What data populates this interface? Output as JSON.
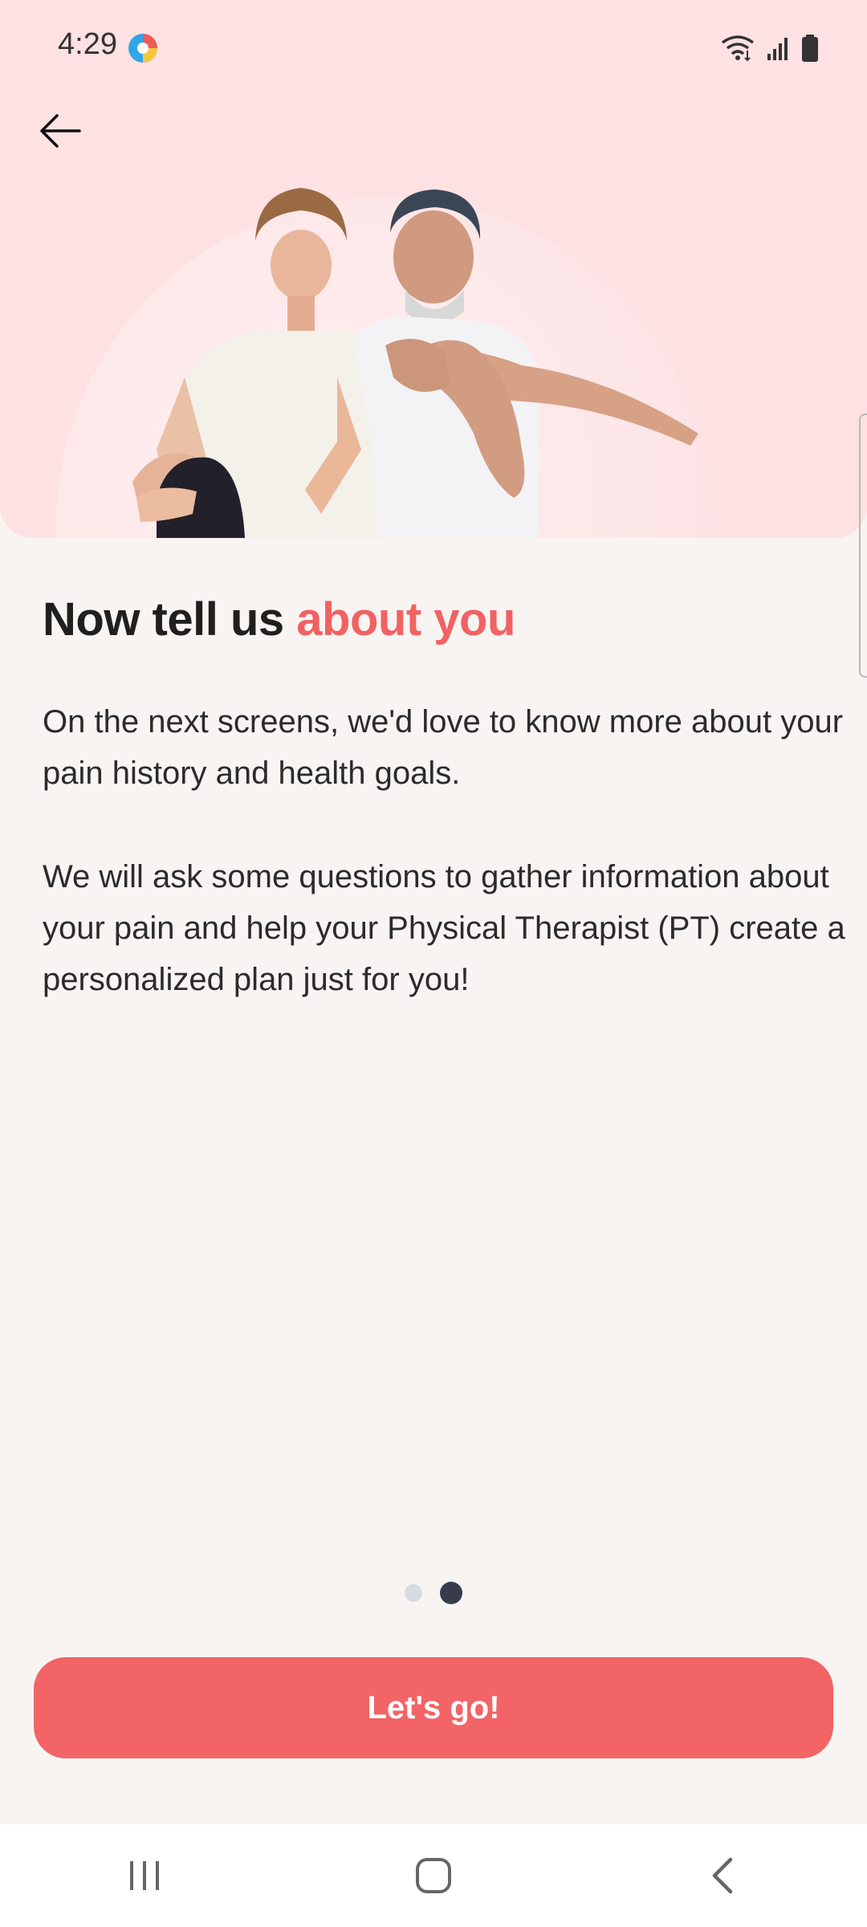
{
  "status_bar": {
    "time": "4:29",
    "icons": [
      "wifi-icon",
      "signal-icon",
      "battery-icon"
    ]
  },
  "header": {
    "back_icon": "arrow-left-icon"
  },
  "hero": {
    "image": "two-people-stretching-illustration"
  },
  "main": {
    "title_plain": "Now tell us",
    "title_accent": "about you",
    "paragraph1": "On the next screens, we'd love to know more about your pain history and health goals.",
    "paragraph2": "We will ask some questions to gather information about your pain and help your Physical Therapist (PT) create a personalized plan just for you!"
  },
  "pager": {
    "total": 2,
    "current": 2
  },
  "cta": {
    "label": "Let's go!"
  },
  "nav": {
    "icons": [
      "recent-apps-icon",
      "home-icon",
      "back-nav-icon"
    ]
  },
  "colors": {
    "accent": "#f16263",
    "button": "#f26466",
    "hero_bg": "#fde1e3",
    "page_bg": "#f8f4f2",
    "dot_active": "#363c4a",
    "dot_inactive": "#d8dbe2"
  }
}
